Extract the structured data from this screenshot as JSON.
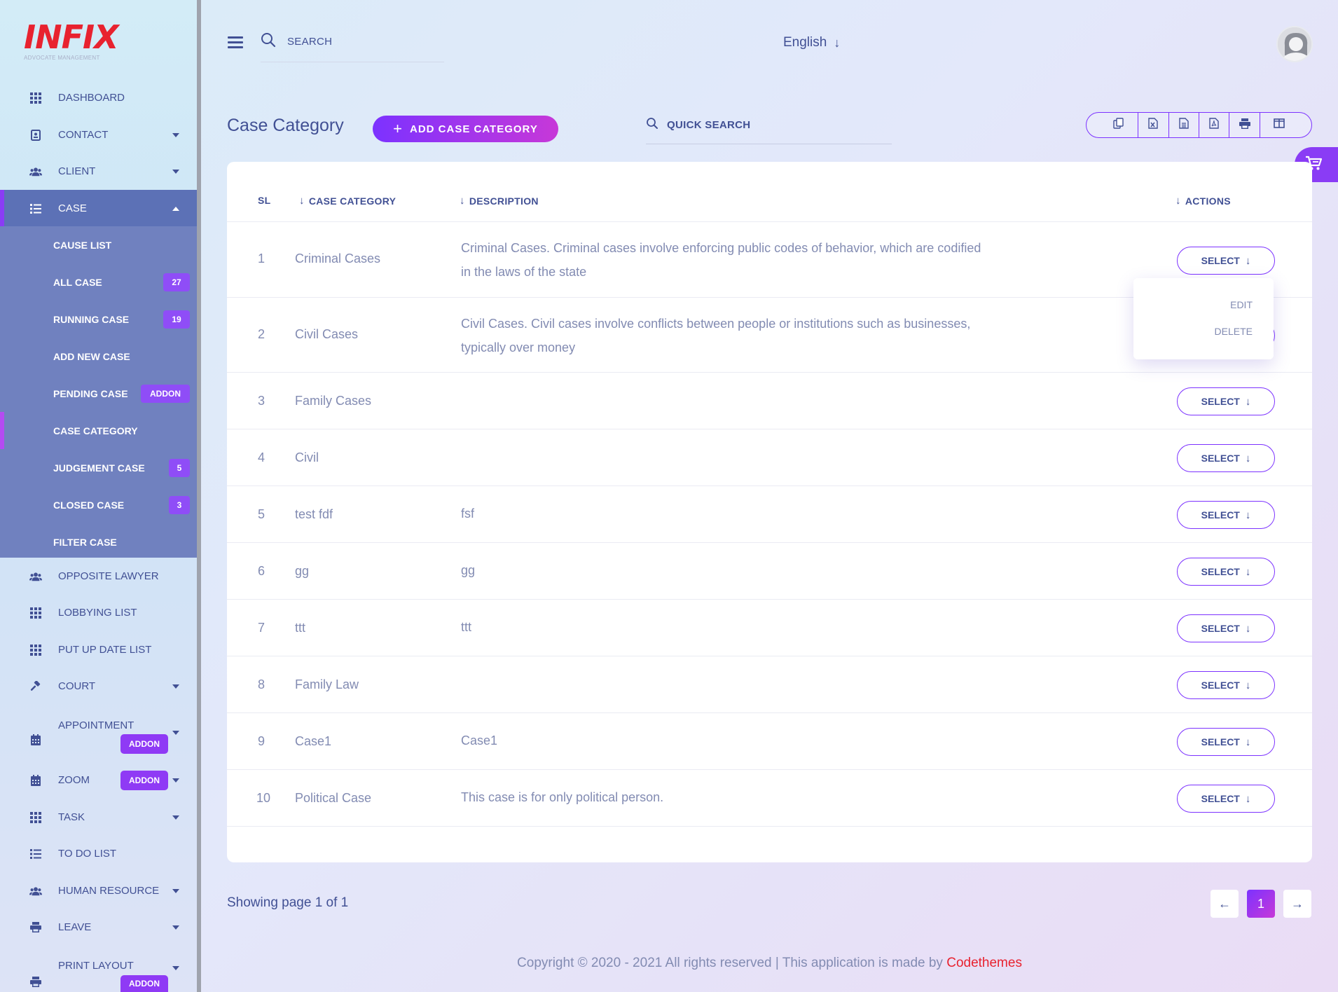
{
  "brand": {
    "logo_text": "INFIX",
    "logo_sub": "ADVOCATE MANAGEMENT"
  },
  "topbar": {
    "search_label": "SEARCH",
    "language": "English"
  },
  "sidebar": {
    "items": [
      {
        "label": "DASHBOARD",
        "icon": "grid-icon"
      },
      {
        "label": "CONTACT",
        "icon": "contact-icon"
      },
      {
        "label": "CLIENT",
        "icon": "users-icon"
      },
      {
        "label": "CASE",
        "icon": "list-icon"
      },
      {
        "label": "OPPOSITE LAWYER",
        "icon": "users-icon"
      },
      {
        "label": "LOBBYING LIST",
        "icon": "grid-icon"
      },
      {
        "label": "PUT UP DATE LIST",
        "icon": "grid-icon"
      },
      {
        "label": "COURT",
        "icon": "gavel-icon"
      },
      {
        "label": "APPOINTMENT",
        "icon": "calendar-icon",
        "addon": "ADDON"
      },
      {
        "label": "ZOOM",
        "icon": "calendar-icon",
        "addon": "ADDON"
      },
      {
        "label": "TASK",
        "icon": "grid-icon"
      },
      {
        "label": "TO DO LIST",
        "icon": "list-icon"
      },
      {
        "label": "HUMAN RESOURCE",
        "icon": "users-icon"
      },
      {
        "label": "LEAVE",
        "icon": "print-icon"
      },
      {
        "label": "PRINT LAYOUT",
        "icon": "print-icon",
        "addon": "ADDON"
      }
    ],
    "case_submenu": [
      {
        "label": "CAUSE LIST"
      },
      {
        "label": "ALL CASE",
        "badge": "27"
      },
      {
        "label": "RUNNING CASE",
        "badge": "19"
      },
      {
        "label": "ADD NEW CASE"
      },
      {
        "label": "PENDING CASE",
        "badge": "ADDON"
      },
      {
        "label": "CASE CATEGORY"
      },
      {
        "label": "JUDGEMENT CASE",
        "badge": "5"
      },
      {
        "label": "CLOSED CASE",
        "badge": "3"
      },
      {
        "label": "FILTER CASE"
      }
    ]
  },
  "main": {
    "title": "Case Category",
    "add_button": "ADD CASE CATEGORY",
    "quick_search": "QUICK SEARCH",
    "export_icons": [
      "copy-icon",
      "excel-icon",
      "csv-icon",
      "pdf-icon",
      "print-icon",
      "columns-icon"
    ]
  },
  "table": {
    "headers": {
      "sl": "SL",
      "category": "CASE CATEGORY",
      "description": "DESCRIPTION",
      "actions": "ACTIONS"
    },
    "select_label": "SELECT",
    "rows": [
      {
        "sl": "1",
        "category": "Criminal Cases",
        "description": "Criminal Cases. Criminal cases involve enforcing public codes of behavior, which are codified in the laws of the state"
      },
      {
        "sl": "2",
        "category": "Civil Cases",
        "description": "Civil Cases. Civil cases involve conflicts between people or institutions such as businesses, typically over money"
      },
      {
        "sl": "3",
        "category": "Family Cases",
        "description": ""
      },
      {
        "sl": "4",
        "category": "Civil",
        "description": ""
      },
      {
        "sl": "5",
        "category": "test fdf",
        "description": "fsf"
      },
      {
        "sl": "6",
        "category": "gg",
        "description": "gg"
      },
      {
        "sl": "7",
        "category": "ttt",
        "description": "ttt"
      },
      {
        "sl": "8",
        "category": "Family Law",
        "description": ""
      },
      {
        "sl": "9",
        "category": "Case1",
        "description": "Case1"
      },
      {
        "sl": "10",
        "category": "Political Case",
        "description": "This case is for only political person."
      }
    ],
    "dropdown": {
      "edit": "EDIT",
      "delete": "DELETE"
    }
  },
  "pagination": {
    "showing": "Showing page 1 of 1",
    "current": "1"
  },
  "footer": {
    "text": "Copyright © 2020 - 2021 All rights reserved | This application is made by",
    "brand": "Codethemes"
  },
  "colors": {
    "accent": "#7c32ff",
    "brand_red": "#e8222f",
    "text": "#415094",
    "muted": "#828bb2"
  }
}
